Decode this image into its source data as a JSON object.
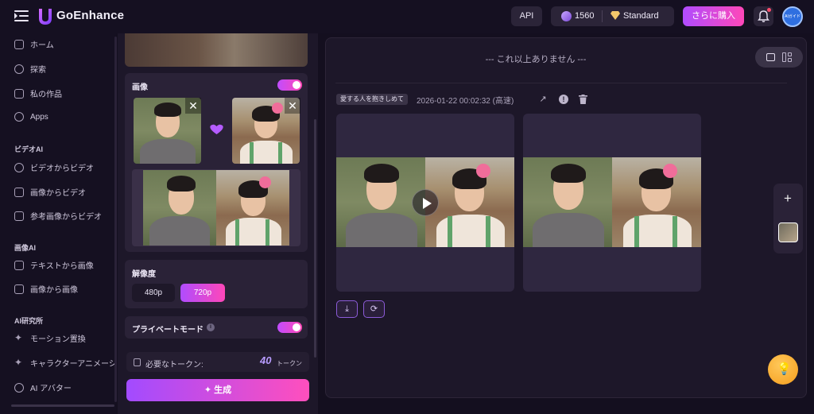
{
  "header": {
    "brand": "GoEnhance",
    "api_label": "API",
    "credits": "1560",
    "plan": "Standard",
    "buy_label": "さらに購入",
    "avatar_text": "AIガイド"
  },
  "sidebar": {
    "items_top": [
      {
        "label": "ホーム",
        "icon": "home-icon"
      },
      {
        "label": "探索",
        "icon": "compass-icon"
      },
      {
        "label": "私の作品",
        "icon": "works-icon"
      },
      {
        "label": "Apps",
        "icon": "apps-icon"
      }
    ],
    "video_section": "ビデオAI",
    "video_items": [
      {
        "label": "ビデオからビデオ",
        "icon": "video-icon"
      },
      {
        "label": "画像からビデオ",
        "icon": "image-video-icon"
      },
      {
        "label": "参考画像からビデオ",
        "icon": "reference-icon"
      }
    ],
    "image_section": "画像AI",
    "image_items": [
      {
        "label": "テキストから画像",
        "icon": "text-image-icon"
      },
      {
        "label": "画像から画像",
        "icon": "image-image-icon"
      }
    ],
    "lab_section": "AI研究所",
    "lab_items": [
      {
        "label": "モーション置換",
        "icon": "sparkle-icon"
      },
      {
        "label": "キャラクターアニメーシ",
        "icon": "sparkle-icon"
      },
      {
        "label": "AI アバター",
        "icon": "avatar-icon"
      }
    ]
  },
  "panel": {
    "image_title": "画像",
    "resolution_title": "解像度",
    "res_options": [
      "480p",
      "720p"
    ],
    "res_selected": "720p",
    "private_title": "プライベートモード",
    "token_label": "必要なトークン:",
    "token_value": "40",
    "token_unit": "トークン",
    "generate_label": "✦ 生成"
  },
  "main": {
    "end_text": "--- これ以上ありません ---",
    "prompt_tag": "愛する人を抱きしめて",
    "timestamp": "2026-01-22 00:02:32 (高速)"
  },
  "colors": {
    "accent_start": "#b04cff",
    "accent_end": "#ff47b8",
    "background": "#140f1f"
  }
}
